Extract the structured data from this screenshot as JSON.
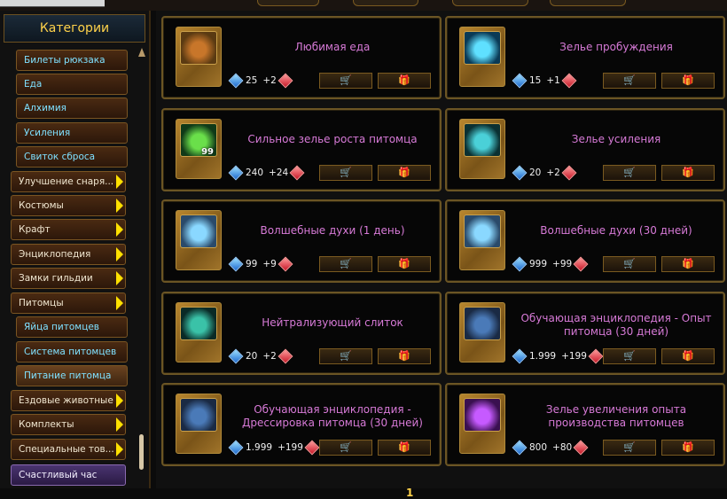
{
  "sidebar": {
    "title": "Категории",
    "items": [
      {
        "label": "Билеты рюкзака",
        "sub": true
      },
      {
        "label": "Еда",
        "sub": true
      },
      {
        "label": "Алхимия",
        "sub": true
      },
      {
        "label": "Усиления",
        "sub": true
      },
      {
        "label": "Свиток сброса",
        "sub": true
      },
      {
        "label": "Улучшение снаря...",
        "arrow": true
      },
      {
        "label": "Костюмы",
        "arrow": true
      },
      {
        "label": "Крафт",
        "arrow": true
      },
      {
        "label": "Энциклопедия",
        "arrow": true
      },
      {
        "label": "Замки гильдии",
        "arrow": true
      },
      {
        "label": "Питомцы",
        "arrow": true
      },
      {
        "label": "Яйца питомцев",
        "sub": true
      },
      {
        "label": "Система питомцев",
        "sub": true
      },
      {
        "label": "Питание питомца",
        "sub": true,
        "active": true
      },
      {
        "label": "Ездовые животные",
        "arrow": true
      },
      {
        "label": "Комплекты",
        "arrow": true
      },
      {
        "label": "Специальные тов...",
        "arrow": true
      },
      {
        "label": "Счастливый час",
        "purple": true
      }
    ]
  },
  "products": [
    {
      "name": "Любимая еда",
      "price": "25",
      "bonus": "+2",
      "icon": "roast-chicken-icon",
      "qty": ""
    },
    {
      "name": "Зелье пробуждения",
      "price": "15",
      "bonus": "+1",
      "icon": "blue-potion-icon",
      "qty": ""
    },
    {
      "name": "Сильное зелье роста питомца",
      "price": "240",
      "bonus": "+24",
      "icon": "green-potion-icon",
      "qty": "99"
    },
    {
      "name": "Зелье усиления",
      "price": "20",
      "bonus": "+2",
      "icon": "cyan-potion-icon",
      "qty": ""
    },
    {
      "name": "Волшебные духи (1 день)",
      "price": "99",
      "bonus": "+9",
      "icon": "perfume-bottle-icon",
      "qty": ""
    },
    {
      "name": "Волшебные духи (30 дней)",
      "price": "999",
      "bonus": "+99",
      "icon": "perfume-bottle-icon",
      "qty": ""
    },
    {
      "name": "Нейтрализующий слиток",
      "price": "20",
      "bonus": "+2",
      "icon": "ingot-icon",
      "qty": ""
    },
    {
      "name": "Обучающая энциклопедия - Опыт питомца (30 дней)",
      "price": "1.999",
      "bonus": "+199",
      "icon": "book-icon",
      "qty": ""
    },
    {
      "name": "Обучающая энциклопедия - Дрессировка питомца (30 дней)",
      "price": "1.999",
      "bonus": "+199",
      "icon": "book-icon",
      "qty": ""
    },
    {
      "name": "Зелье увеличения опыта производства питомцев",
      "price": "800",
      "bonus": "+80",
      "icon": "purple-potion-icon",
      "qty": ""
    }
  ],
  "icons": {
    "cart": "shopping-cart-icon",
    "gift": "gift-icon",
    "currency": "blue-gem-icon",
    "bonus_currency": "red-gem-icon"
  },
  "colors": {
    "title_text": "#d77ad7",
    "category_header": "#ffd24a",
    "subcategory_text": "#7fe0ff"
  },
  "pagination": {
    "current": "1"
  }
}
